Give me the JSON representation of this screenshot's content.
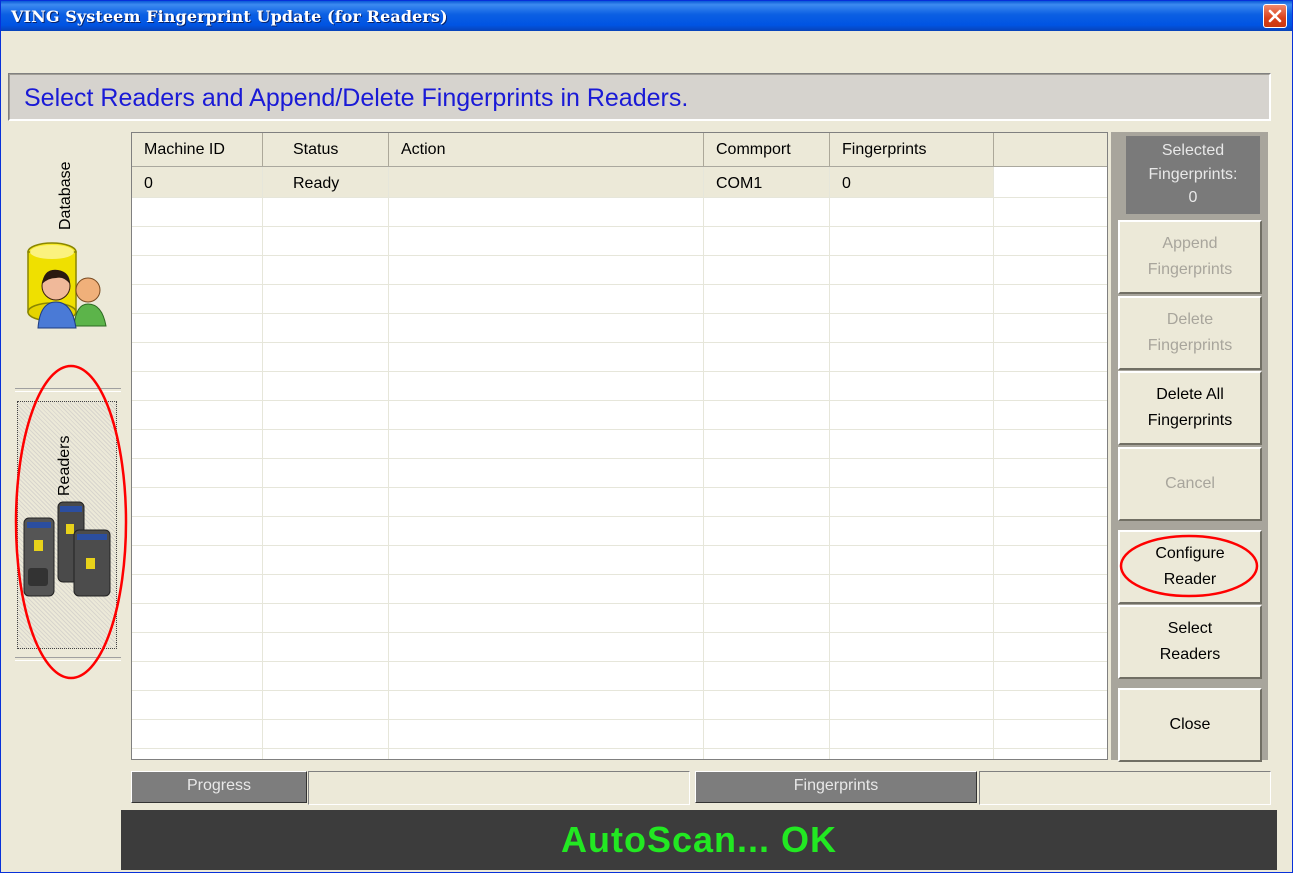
{
  "window": {
    "title": "VING Systeem Fingerprint Update (for Readers)",
    "banner": "Select Readers and Append/Delete Fingerprints in Readers."
  },
  "left_tabs": {
    "database_label": "Database",
    "readers_label": "Readers"
  },
  "grid": {
    "columns": [
      "Machine ID",
      "Status",
      "Action",
      "Commport",
      "Fingerprints",
      ""
    ],
    "rows": [
      {
        "machine_id": "0",
        "status": "Ready",
        "action": "",
        "commport": "COM1",
        "fingerprints": "0"
      }
    ]
  },
  "right_panel": {
    "selected_fingerprints_label": "Selected\nFingerprints:",
    "selected_fingerprints_count": "0",
    "buttons": {
      "append": "Append\nFingerprints",
      "delete": "Delete\nFingerprints",
      "delete_all": "Delete All\nFingerprints",
      "cancel": "Cancel",
      "configure": "Configure\nReader",
      "select": "Select\nReaders",
      "close": "Close"
    }
  },
  "status": {
    "progress_label": "Progress",
    "fingerprints_label": "Fingerprints",
    "console_message": "AutoScan... OK"
  },
  "colors": {
    "annotation": "#ff0000",
    "console_text": "#22e822",
    "banner_text": "#1a1ad6"
  }
}
